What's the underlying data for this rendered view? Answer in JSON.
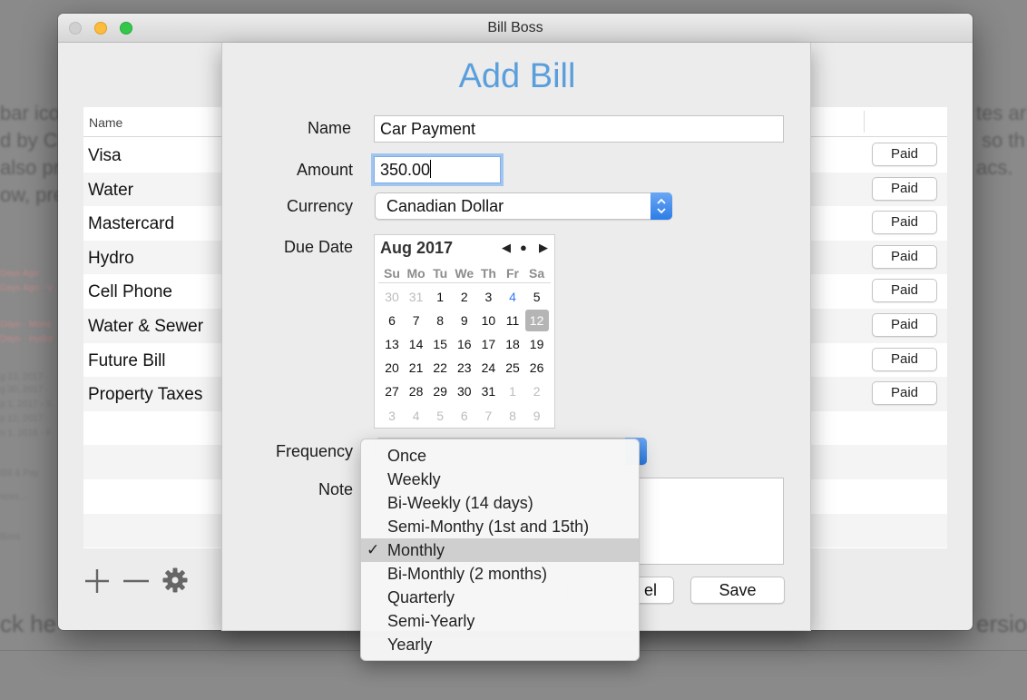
{
  "window": {
    "title": "Bill Boss"
  },
  "background": {
    "fragments": [
      "bar ico",
      "d by C",
      "also pr",
      "ow, pre",
      "tes ar",
      "so th",
      "acs.",
      "ck he",
      "ersio"
    ],
    "small_fragments": [
      "Days Ago",
      "Days Ago - V",
      "Days - Mons",
      "Days - Hydro",
      "g 23, 2017 -",
      "g 30, 2017 -",
      "p 1, 2017 - S",
      "p 12, 2017 -",
      "n 1, 2018 - F",
      "Bill & Pay",
      "nces...",
      "Boss"
    ]
  },
  "table": {
    "header_name": "Name",
    "rows": [
      {
        "name": "Visa",
        "action": "Paid"
      },
      {
        "name": "Water",
        "action": "Paid"
      },
      {
        "name": "Mastercard",
        "action": "Paid"
      },
      {
        "name": "Hydro",
        "action": "Paid"
      },
      {
        "name": "Cell Phone",
        "action": "Paid"
      },
      {
        "name": "Water & Sewer",
        "action": "Paid"
      },
      {
        "name": "Future Bill",
        "action": "Paid"
      },
      {
        "name": "Property Taxes",
        "action": "Paid"
      }
    ]
  },
  "toolbar": {
    "add_icon": "plus-icon",
    "remove_icon": "minus-icon",
    "settings_icon": "gear-icon"
  },
  "sheet": {
    "title": "Add Bill",
    "labels": {
      "name": "Name",
      "amount": "Amount",
      "currency": "Currency",
      "due_date": "Due Date",
      "frequency": "Frequency",
      "note": "Note"
    },
    "fields": {
      "name": "Car Payment",
      "amount": "350.00",
      "currency": "Canadian Dollar"
    },
    "buttons": {
      "cancel_partial": "el",
      "save": "Save"
    },
    "accent": "#5a9fdc"
  },
  "calendar": {
    "month_label": "Aug 2017",
    "weekdays": [
      "Su",
      "Mo",
      "Tu",
      "We",
      "Th",
      "Fr",
      "Sa"
    ],
    "weeks": [
      [
        "30",
        "31",
        "1",
        "2",
        "3",
        "4",
        "5"
      ],
      [
        "6",
        "7",
        "8",
        "9",
        "10",
        "11",
        "12"
      ],
      [
        "13",
        "14",
        "15",
        "16",
        "17",
        "18",
        "19"
      ],
      [
        "20",
        "21",
        "22",
        "23",
        "24",
        "25",
        "26"
      ],
      [
        "27",
        "28",
        "29",
        "30",
        "31",
        "1",
        "2"
      ],
      [
        "3",
        "4",
        "5",
        "6",
        "7",
        "8",
        "9"
      ]
    ],
    "today": "4",
    "selected": "12",
    "nav": {
      "prev": "◀",
      "today": "●",
      "next": "▶"
    }
  },
  "frequency_menu": {
    "options": [
      "Once",
      "Weekly",
      "Bi-Weekly (14 days)",
      "Semi-Monthy (1st and 15th)",
      "Monthly",
      "Bi-Monthly (2 months)",
      "Quarterly",
      "Semi-Yearly",
      "Yearly"
    ],
    "checked": "Monthly",
    "check_mark": "✓"
  }
}
